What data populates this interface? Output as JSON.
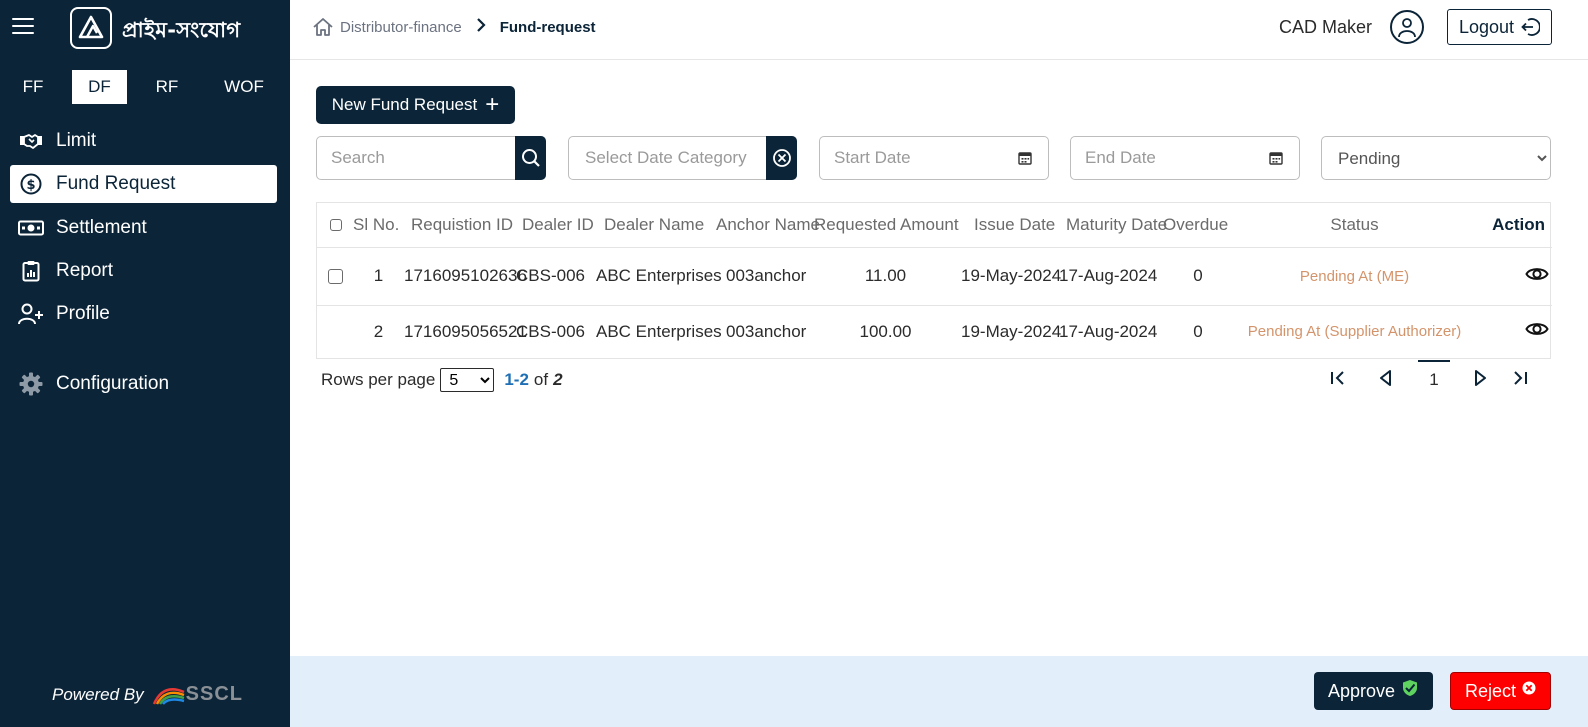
{
  "sidebar": {
    "brand": "প্রাইম-সংযোগ",
    "module_tabs": [
      {
        "label": "FF",
        "active": false
      },
      {
        "label": "DF",
        "active": true
      },
      {
        "label": "RF",
        "active": false
      },
      {
        "label": "WOF",
        "active": false
      }
    ],
    "nav": [
      {
        "label": "Limit",
        "icon": "handshake-icon",
        "active": false
      },
      {
        "label": "Fund Request",
        "icon": "dollar-circle-icon",
        "active": true
      },
      {
        "label": "Settlement",
        "icon": "banknote-icon",
        "active": false
      },
      {
        "label": "Report",
        "icon": "clipboard-icon",
        "active": false
      },
      {
        "label": "Profile",
        "icon": "user-plus-icon",
        "active": false
      },
      {
        "label": "Configuration",
        "icon": "gear-icon",
        "active": false
      }
    ],
    "powered_by": "Powered By",
    "powered_logo": "SSCL"
  },
  "header": {
    "breadcrumb": [
      "Distributor-finance",
      "Fund-request"
    ],
    "user": "CAD Maker",
    "logout": "Logout"
  },
  "toolbar": {
    "new_request": "New Fund Request",
    "search_placeholder": "Search",
    "date_category_placeholder": "Select Date Category",
    "start_date_placeholder": "Start Date",
    "end_date_placeholder": "End Date",
    "status_filter": "Pending"
  },
  "table": {
    "columns": [
      "Sl No.",
      "Requistion ID",
      "Dealer ID",
      "Dealer Name",
      "Anchor Name",
      "Requested Amount",
      "Issue Date",
      "Maturity Date",
      "Overdue",
      "Status",
      "Action"
    ],
    "rows": [
      {
        "sl": "1",
        "requisition_id": "1716095102636",
        "dealer_id": "CBS-006",
        "dealer_name": "ABC Enterprises",
        "anchor_name": "003anchor",
        "amount": "11.00",
        "issue_date": "19-May-2024",
        "maturity_date": "17-Aug-2024",
        "overdue": "0",
        "status": "Pending At (ME)",
        "has_checkbox": true
      },
      {
        "sl": "2",
        "requisition_id": "1716095056521",
        "dealer_id": "CBS-006",
        "dealer_name": "ABC Enterprises",
        "anchor_name": "003anchor",
        "amount": "100.00",
        "issue_date": "19-May-2024",
        "maturity_date": "17-Aug-2024",
        "overdue": "0",
        "status": "Pending At (Supplier Authorizer)",
        "has_checkbox": false
      }
    ]
  },
  "pagination": {
    "rows_per_page_label": "Rows per page",
    "rows_per_page": "5",
    "range": "1-2",
    "of": "of",
    "total": "2",
    "current_page": "1"
  },
  "footer": {
    "approve": "Approve",
    "reject": "Reject"
  },
  "colors": {
    "sidebar_bg": "#0b2438",
    "status_text": "#d4946b",
    "footer_bg": "#e3eefb",
    "reject_bg": "#ff0000",
    "range_text": "#1f6fb5"
  }
}
